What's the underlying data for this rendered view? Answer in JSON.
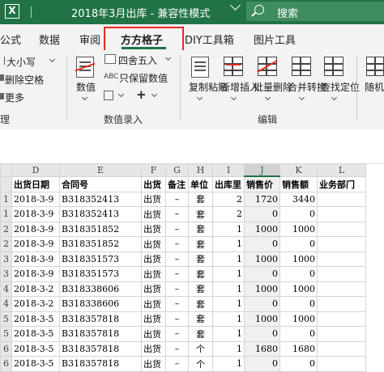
{
  "titlebar": {
    "app_icon": "X",
    "title": "2018年3月出库 - 兼容性模式",
    "search_placeholder": "搜索",
    "bg": "#217346"
  },
  "tabs": [
    {
      "label": "公式"
    },
    {
      "label": "数据"
    },
    {
      "label": "审阅"
    },
    {
      "label": "方方格子",
      "active": true
    },
    {
      "label": "DIY工具箱"
    },
    {
      "label": "图片工具"
    }
  ],
  "ribbon": {
    "left": {
      "size_label": "大小写",
      "delete_space_label": "删除空格",
      "more_label": "更多",
      "process_label": "理"
    },
    "data_group": {
      "number_label": "数值",
      "round_label": "四舍五入",
      "keep_number_label": "只保留数值",
      "group_label": "数值录入"
    },
    "edit_group": {
      "copy_paste_label": "复制粘贴",
      "new_insert_label": "新增插入",
      "batch_delete_label": "批量删除",
      "merge_convert_label": "合并转换",
      "find_locate_label": "查找定位",
      "group_label": "编辑"
    },
    "right": {
      "random_label": "随机"
    }
  },
  "sheet": {
    "columns": [
      "",
      "D",
      "E",
      "F",
      "G",
      "H",
      "I",
      "J",
      "K",
      "L"
    ],
    "headers": [
      "",
      "出货日期",
      "合同号",
      "出货",
      "备注",
      "单位",
      "出库里",
      "销售价",
      "销售额",
      "业务部门"
    ],
    "rows": [
      {
        "r": "1",
        "date": "2018-3-9",
        "contract": "B318352413",
        "type": "出货",
        "note": "–",
        "unit": "套",
        "qty": "2",
        "price": "1720",
        "amount": "3440"
      },
      {
        "r": "1",
        "date": "2018-3-9",
        "contract": "B318352413",
        "type": "出货",
        "note": "–",
        "unit": "套",
        "qty": "2",
        "price": "0",
        "amount": "0"
      },
      {
        "r": "2",
        "date": "2018-3-9",
        "contract": "B318351852",
        "type": "出货",
        "note": "–",
        "unit": "套",
        "qty": "1",
        "price": "1000",
        "amount": "1000"
      },
      {
        "r": "2",
        "date": "2018-3-9",
        "contract": "B318351852",
        "type": "出货",
        "note": "–",
        "unit": "套",
        "qty": "1",
        "price": "0",
        "amount": "0"
      },
      {
        "r": "3",
        "date": "2018-3-9",
        "contract": "B318351573",
        "type": "出货",
        "note": "–",
        "unit": "套",
        "qty": "1",
        "price": "1000",
        "amount": "1000"
      },
      {
        "r": "3",
        "date": "2018-3-9",
        "contract": "B318351573",
        "type": "出货",
        "note": "–",
        "unit": "套",
        "qty": "1",
        "price": "0",
        "amount": "0"
      },
      {
        "r": "4",
        "date": "2018-3-2",
        "contract": "B318338606",
        "type": "出货",
        "note": "–",
        "unit": "套",
        "qty": "1",
        "price": "1000",
        "amount": "1000"
      },
      {
        "r": "4",
        "date": "2018-3-2",
        "contract": "B318338606",
        "type": "出货",
        "note": "–",
        "unit": "套",
        "qty": "1",
        "price": "0",
        "amount": "0"
      },
      {
        "r": "5",
        "date": "2018-3-5",
        "contract": "B318357818",
        "type": "出货",
        "note": "–",
        "unit": "套",
        "qty": "1",
        "price": "1000",
        "amount": "1000"
      },
      {
        "r": "5",
        "date": "2018-3-5",
        "contract": "B318357818",
        "type": "出货",
        "note": "–",
        "unit": "套",
        "qty": "1",
        "price": "0",
        "amount": "0"
      },
      {
        "r": "6",
        "date": "2018-3-5",
        "contract": "B318357818",
        "type": "出货",
        "note": "–",
        "unit": "个",
        "qty": "1",
        "price": "1680",
        "amount": "1680"
      },
      {
        "r": "6",
        "date": "2018-3-5",
        "contract": "B318357818",
        "type": "出货",
        "note": "–",
        "unit": "个",
        "qty": "1",
        "price": "0",
        "amount": "0"
      }
    ]
  }
}
